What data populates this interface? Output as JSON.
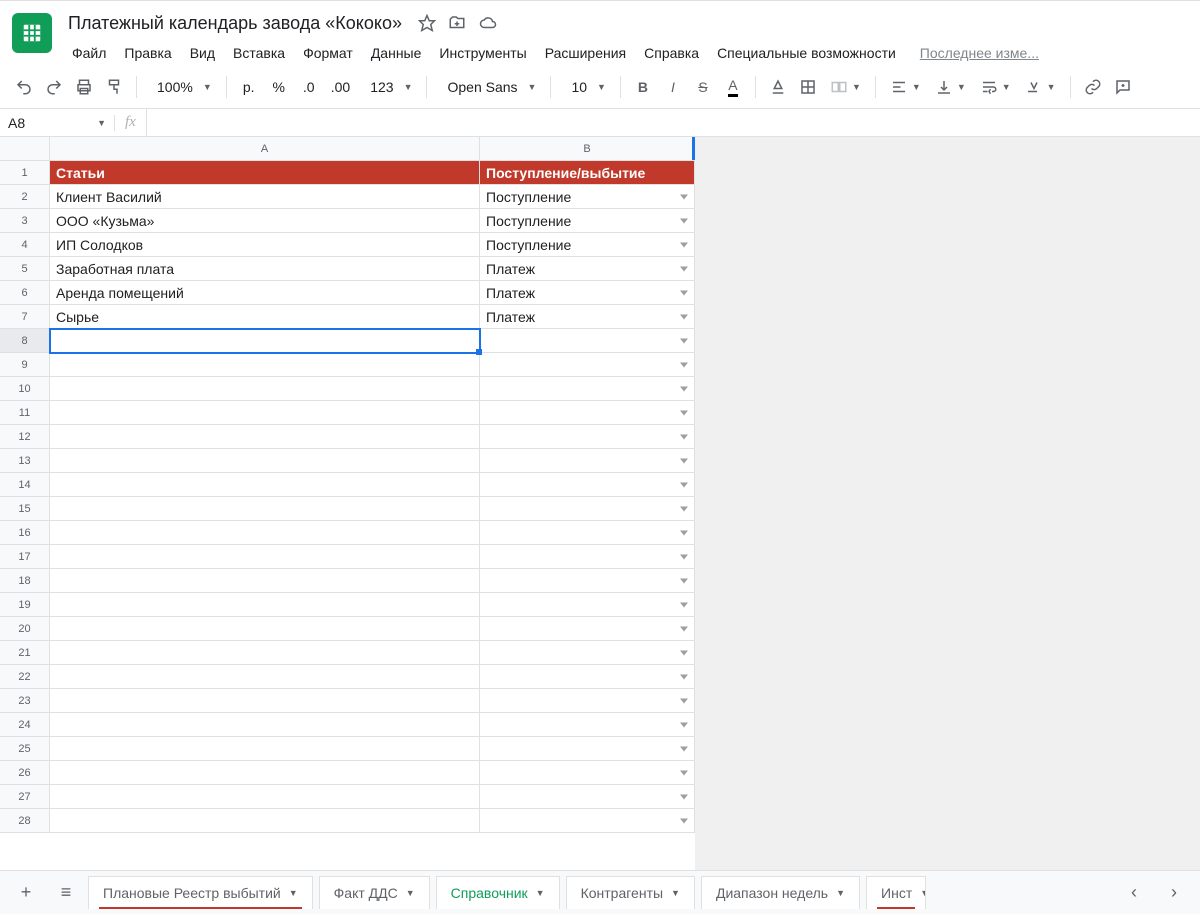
{
  "doc": {
    "title": "Платежный календарь завода «Кококо»",
    "last_edit": "Последнее изме..."
  },
  "menus": [
    "Файл",
    "Правка",
    "Вид",
    "Вставка",
    "Формат",
    "Данные",
    "Инструменты",
    "Расширения",
    "Справка",
    "Специальные возможности"
  ],
  "toolbar": {
    "zoom": "100%",
    "currency": "р.",
    "percent": "%",
    "dec_dec": ".0",
    "inc_dec": ".00",
    "more_fmt": "123",
    "font": "Open Sans",
    "font_size": "10"
  },
  "namebox": "A8",
  "fx_placeholder": "fx",
  "columns": [
    "A",
    "B"
  ],
  "header_row": {
    "a": "Статьи",
    "b": "Поступление/выбытие"
  },
  "rows": [
    {
      "a": "Клиент Василий",
      "b": "Поступление"
    },
    {
      "a": "ООО «Кузьма»",
      "b": "Поступление"
    },
    {
      "a": "ИП Солодков",
      "b": "Поступление"
    },
    {
      "a": "Заработная плата",
      "b": "Платеж"
    },
    {
      "a": "Аренда помещений",
      "b": "Платеж"
    },
    {
      "a": "Сырье",
      "b": "Платеж"
    }
  ],
  "visible_row_count": 28,
  "selected_row": 8,
  "sheets": [
    {
      "label": "Плановые Реестр выбытий",
      "active": false,
      "indicator": "red"
    },
    {
      "label": "Факт ДДС",
      "active": false
    },
    {
      "label": "Справочник",
      "active": true
    },
    {
      "label": "Контрагенты",
      "active": false
    },
    {
      "label": "Диапазон недель",
      "active": false
    },
    {
      "label": "Инст",
      "active": false,
      "partial": true,
      "indicator": "red"
    }
  ]
}
